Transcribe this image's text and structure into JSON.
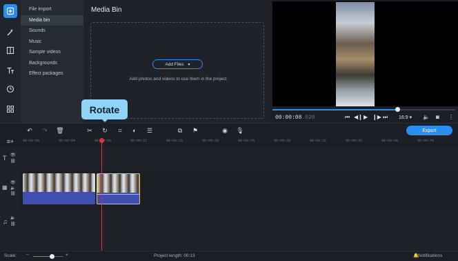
{
  "sidebar": {
    "items": [
      {
        "label": "File import"
      },
      {
        "label": "Media bin"
      },
      {
        "label": "Sounds"
      },
      {
        "label": "Music"
      },
      {
        "label": "Sample videos"
      },
      {
        "label": "Backgrounds"
      },
      {
        "label": "Effect packages"
      }
    ]
  },
  "bin": {
    "title": "Media Bin",
    "add_files_label": "Add Files",
    "hint": "Add photos and videos to use them in the project"
  },
  "player": {
    "time_main": "00:00:08",
    "time_frames": ".020",
    "aspect": "16:9 ▾",
    "progress": 0.68
  },
  "toolbar": {
    "export_label": "Export"
  },
  "tooltip": {
    "label": "Rotate"
  },
  "ruler": {
    "ticks": [
      "00:00:00",
      "00:00:04",
      "00:00:08",
      "00:00:12",
      "00:00:16",
      "00:00:20",
      "00:00:24",
      "00:00:28",
      "00:00:32",
      "00:00:36",
      "00:00:40",
      "00:00:44"
    ]
  },
  "status": {
    "scale_label": "Scale:",
    "project_length": "Project length:  00:13",
    "notifications": "Notifications"
  },
  "colors": {
    "accent": "#2b8df0",
    "selection": "#f3c623",
    "playhead": "#e0323a",
    "clip": "#3f4fb0",
    "tooltip": "#8fd3f7"
  }
}
